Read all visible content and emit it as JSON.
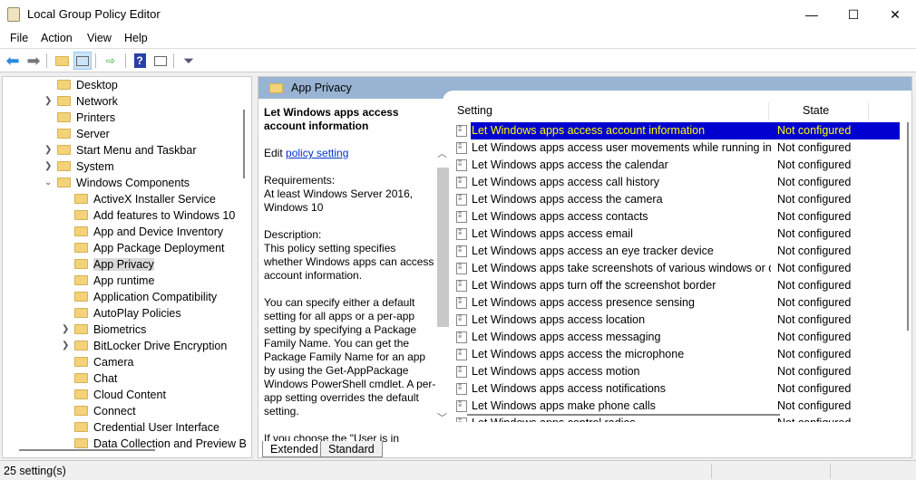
{
  "window": {
    "title": "Local Group Policy Editor",
    "minimize": "—",
    "maximize": "☐",
    "close": "✕"
  },
  "menu": [
    "File",
    "Action",
    "View",
    "Help"
  ],
  "toolbar": [
    "back-icon",
    "forward-icon",
    "up-folder-icon",
    "show-hide-tree-icon",
    "export-list-icon",
    "help-icon",
    "show-hide-action-pane-icon",
    "filter-icon"
  ],
  "tree": [
    {
      "label": "Desktop",
      "level": 1,
      "exp": ""
    },
    {
      "label": "Network",
      "level": 1,
      "exp": ">"
    },
    {
      "label": "Printers",
      "level": 1,
      "exp": ""
    },
    {
      "label": "Server",
      "level": 1,
      "exp": ""
    },
    {
      "label": "Start Menu and Taskbar",
      "level": 1,
      "exp": ">"
    },
    {
      "label": "System",
      "level": 1,
      "exp": ">"
    },
    {
      "label": "Windows Components",
      "level": 1,
      "exp": "v"
    },
    {
      "label": "ActiveX Installer Service",
      "level": 2,
      "exp": ""
    },
    {
      "label": "Add features to Windows 10",
      "level": 2,
      "exp": ""
    },
    {
      "label": "App and Device Inventory",
      "level": 2,
      "exp": ""
    },
    {
      "label": "App Package Deployment",
      "level": 2,
      "exp": ""
    },
    {
      "label": "App Privacy",
      "level": 2,
      "exp": "",
      "selected": true
    },
    {
      "label": "App runtime",
      "level": 2,
      "exp": ""
    },
    {
      "label": "Application Compatibility",
      "level": 2,
      "exp": ""
    },
    {
      "label": "AutoPlay Policies",
      "level": 2,
      "exp": ""
    },
    {
      "label": "Biometrics",
      "level": 2,
      "exp": ">"
    },
    {
      "label": "BitLocker Drive Encryption",
      "level": 2,
      "exp": ">"
    },
    {
      "label": "Camera",
      "level": 2,
      "exp": ""
    },
    {
      "label": "Chat",
      "level": 2,
      "exp": ""
    },
    {
      "label": "Cloud Content",
      "level": 2,
      "exp": ""
    },
    {
      "label": "Connect",
      "level": 2,
      "exp": ""
    },
    {
      "label": "Credential User Interface",
      "level": 2,
      "exp": ""
    },
    {
      "label": "Data Collection and Preview B",
      "level": 2,
      "exp": ""
    }
  ],
  "pane": {
    "header": "App Privacy",
    "desc_title": "Let Windows apps access account information",
    "edit_prefix": "Edit ",
    "edit_link": "policy setting",
    "requirements": "Requirements:\nAt least Windows Server 2016, Windows 10",
    "description": "Description:\nThis policy setting specifies whether Windows apps can access account information.",
    "para2": "You can specify either a default setting for all apps or a per-app setting by specifying a Package Family Name. You can get the Package Family Name for an app by using the Get-AppPackage Windows PowerShell cmdlet. A per-app setting overrides the default setting.",
    "para3": "If you choose the \"User is in"
  },
  "list": {
    "col_setting": "Setting",
    "col_state": "State",
    "rows": [
      {
        "name": "Let Windows apps access account information",
        "state": "Not configured"
      },
      {
        "name": "Let Windows apps access user movements while running in ...",
        "state": "Not configured"
      },
      {
        "name": "Let Windows apps access the calendar",
        "state": "Not configured"
      },
      {
        "name": "Let Windows apps access call history",
        "state": "Not configured"
      },
      {
        "name": "Let Windows apps access the camera",
        "state": "Not configured"
      },
      {
        "name": "Let Windows apps access contacts",
        "state": "Not configured"
      },
      {
        "name": "Let Windows apps access email",
        "state": "Not configured"
      },
      {
        "name": "Let Windows apps access an eye tracker device",
        "state": "Not configured"
      },
      {
        "name": "Let Windows apps take screenshots of various windows or d...",
        "state": "Not configured"
      },
      {
        "name": "Let Windows apps turn off the screenshot border",
        "state": "Not configured"
      },
      {
        "name": "Let Windows apps access presence sensing",
        "state": "Not configured"
      },
      {
        "name": "Let Windows apps access location",
        "state": "Not configured"
      },
      {
        "name": "Let Windows apps access messaging",
        "state": "Not configured"
      },
      {
        "name": "Let Windows apps access the microphone",
        "state": "Not configured"
      },
      {
        "name": "Let Windows apps access motion",
        "state": "Not configured"
      },
      {
        "name": "Let Windows apps access notifications",
        "state": "Not configured"
      },
      {
        "name": "Let Windows apps make phone calls",
        "state": "Not configured"
      },
      {
        "name": "Let Windows apps control radios",
        "state": "Not configured"
      }
    ]
  },
  "tabs": [
    "Extended",
    "Standard"
  ],
  "status": "25 setting(s)"
}
